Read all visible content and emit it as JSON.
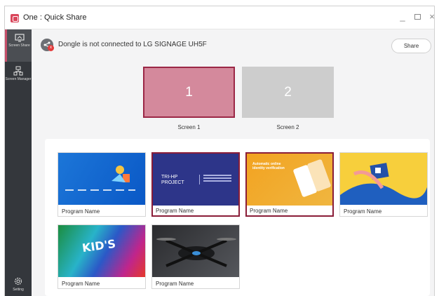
{
  "window": {
    "title": "One : Quick Share",
    "controls": {
      "minimize": "_",
      "maximize": "□",
      "close": "×"
    }
  },
  "sidebar": {
    "items": [
      {
        "label": "Screen Share",
        "icon": "screen-share-icon",
        "active": true
      },
      {
        "label": "Screen Manager",
        "icon": "network-icon",
        "active": false
      },
      {
        "label": "Setting",
        "icon": "gear-icon",
        "active": false
      }
    ]
  },
  "status": {
    "icon": "share-icon",
    "badge": "x",
    "text": "Dongle is not connected to LG SIGNAGE UH5F"
  },
  "share_button": {
    "label": "Share"
  },
  "screens": [
    {
      "number": "1",
      "label": "Screen 1",
      "selected": true
    },
    {
      "number": "2",
      "label": "Screen 2",
      "selected": false
    }
  ],
  "programs": [
    {
      "name": "Program Name",
      "selected": false,
      "theme": "#1c76d8"
    },
    {
      "name": "Program Name",
      "selected": true,
      "theme": "#2d3589",
      "thumb_text": "TRI-HP PROJECT"
    },
    {
      "name": "Program Name",
      "selected": true,
      "theme": "#f2a321",
      "thumb_text": "Automatic online identity verification"
    },
    {
      "name": "Program Name",
      "selected": false,
      "theme": "#f7cf3c"
    },
    {
      "name": "Program Name",
      "selected": false,
      "theme": "#28b3c9",
      "thumb_text": "KID'S"
    },
    {
      "name": "Program Name",
      "selected": false,
      "theme": "#2a2b2e"
    }
  ],
  "colors": {
    "accent": "#9b2746",
    "sidebar_bg": "#34373c",
    "screen_selected_fill": "#d4899c",
    "screen_unselected_fill": "#cdcdcd"
  }
}
